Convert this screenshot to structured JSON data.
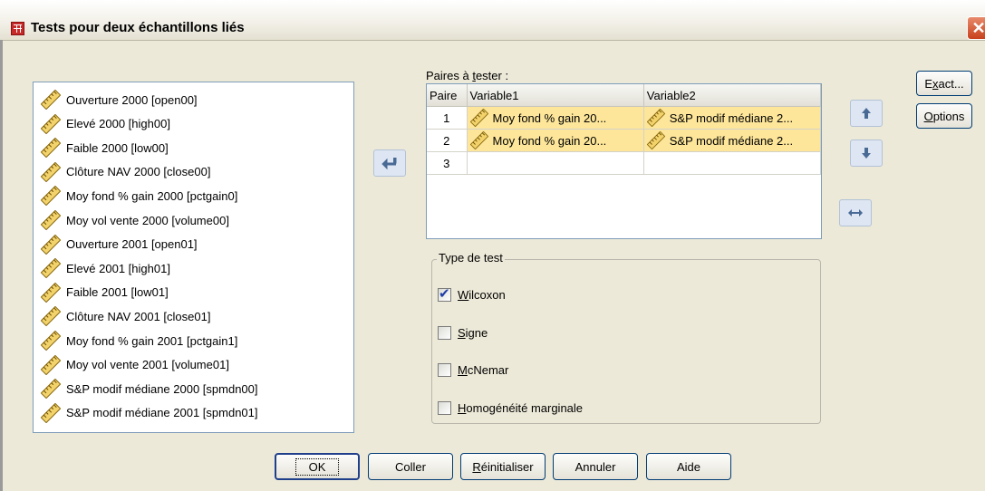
{
  "window": {
    "title": "Tests pour deux échantillons liés",
    "close": "✕"
  },
  "variables": [
    "Ouverture 2000 [open00]",
    "Elevé 2000 [high00]",
    "Faible 2000 [low00]",
    "Clôture NAV 2000 [close00]",
    "Moy fond % gain 2000 [pctgain0]",
    "Moy vol vente 2000 [volume00]",
    "Ouverture 2001 [open01]",
    "Elevé 2001 [high01]",
    "Faible 2001 [low01]",
    "Clôture NAV 2001 [close01]",
    "Moy fond % gain 2001 [pctgain1]",
    "Moy vol vente 2001 [volume01]",
    "S&P modif médiane 2000 [spmdn00]",
    "S&P modif médiane 2001 [spmdn01]"
  ],
  "pairs": {
    "label_pre": "Paires à ",
    "label_ul": "t",
    "label_post": "ester :",
    "headers": {
      "pair": "Paire",
      "var1": "Variable1",
      "var2": "Variable2"
    },
    "rows": [
      {
        "num": "1",
        "var1": "Moy fond % gain 20...",
        "var2": "S&P modif médiane 2..."
      },
      {
        "num": "2",
        "var1": "Moy fond % gain 20...",
        "var2": "S&P modif médiane 2..."
      },
      {
        "num": "3",
        "var1": "",
        "var2": ""
      }
    ]
  },
  "test_type": {
    "legend": "Type de test",
    "options": [
      {
        "ul": "W",
        "rest": "ilcoxon",
        "checked": true
      },
      {
        "ul": "S",
        "rest": "igne",
        "checked": false
      },
      {
        "ul": "M",
        "rest": "cNemar",
        "checked": false
      },
      {
        "ul": "H",
        "rest": "omogénéité marginale",
        "checked": false
      }
    ]
  },
  "side_buttons": {
    "exact_ul": "x",
    "exact_pre": "E",
    "exact_post": "act...",
    "options_ul": "O",
    "options_post": "ptions"
  },
  "bottom_buttons": {
    "ok": "OK",
    "paste": "Coller",
    "reset_ul": "R",
    "reset_post": "éinitialiser",
    "cancel": "Annuler",
    "help": "Aide"
  }
}
